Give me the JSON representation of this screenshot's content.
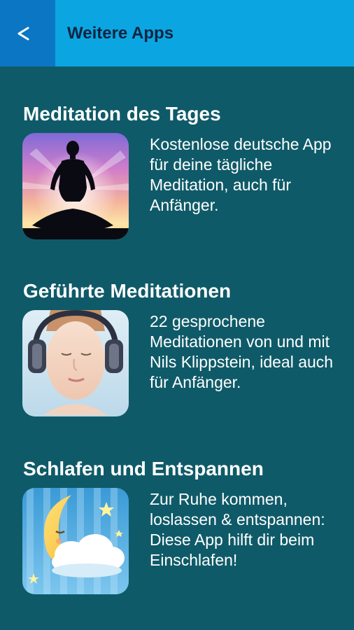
{
  "appbar": {
    "back_label": "<",
    "title": "Weitere Apps",
    "back_icon": "chevron-left-icon",
    "color": "#0ba6e2",
    "back_color": "#0b76c4"
  },
  "apps": [
    {
      "title": "Meditation des Tages",
      "description": "Kostenlose deutsche App für deine tägliche Meditation, auch für Anfänger.",
      "icon": "meditation-silhouette-icon"
    },
    {
      "title": "Geführte Meditationen",
      "description": "22 gesprochene Meditationen von und mit Nils Klippstein, ideal auch für Anfänger.",
      "icon": "headphones-woman-icon"
    },
    {
      "title": "Schlafen und Entspannen",
      "description": "Zur Ruhe kommen, loslassen & entspannen: Diese App hilft dir beim Einschlafen!",
      "icon": "sleeping-moon-icon"
    }
  ],
  "colors": {
    "background": "#0f5a68",
    "title_text": "#0c2440"
  }
}
